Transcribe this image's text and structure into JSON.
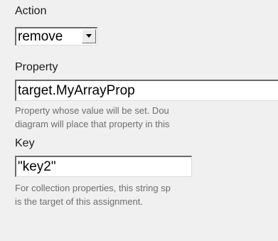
{
  "action": {
    "label": "Action",
    "selected": "remove",
    "dropdown_icon": "chevron-down-icon"
  },
  "property": {
    "label": "Property",
    "value": "target.MyArrayProp",
    "help_line1": "Property whose value will be set. Dou",
    "help_line2": "diagram will place that property in this"
  },
  "key": {
    "label": "Key",
    "value": "\"key2\"",
    "help_line1": "For collection properties, this string sp",
    "help_line2": "is the target of this assignment."
  }
}
